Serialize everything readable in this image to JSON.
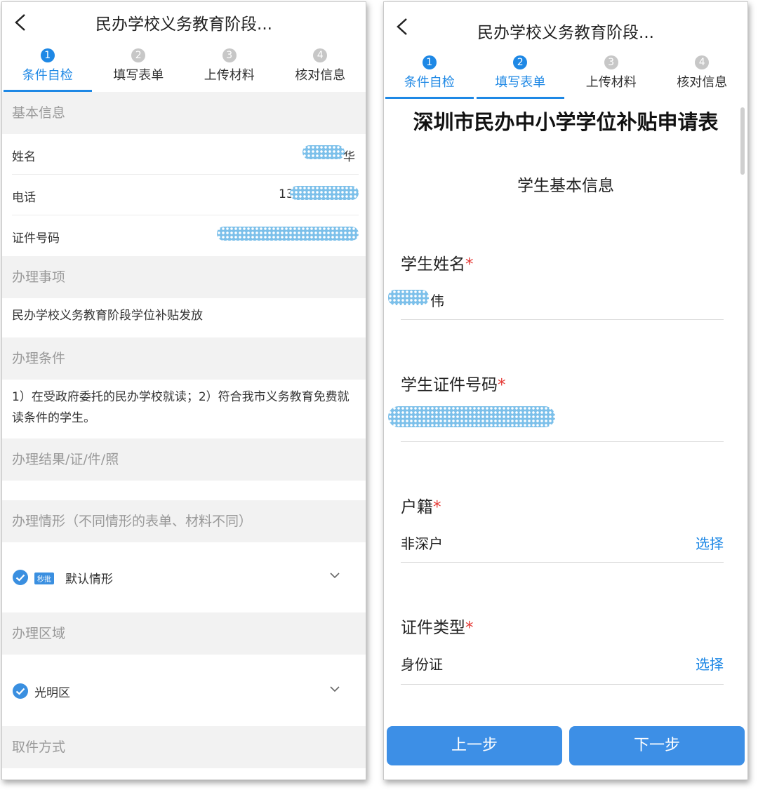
{
  "left_screen": {
    "title": "民办学校义务教育阶段...",
    "steps": [
      {
        "num": "1",
        "label": "条件自检"
      },
      {
        "num": "2",
        "label": "填写表单"
      },
      {
        "num": "3",
        "label": "上传材料"
      },
      {
        "num": "4",
        "label": "核对信息"
      }
    ],
    "basic_info_header": "基本信息",
    "name_label": "姓名",
    "name_value_suffix": "华",
    "phone_label": "电话",
    "phone_value_prefix": "13",
    "id_label": "证件号码",
    "matter_header": "办理事项",
    "matter_text": "民办学校义务教育阶段学位补贴发放",
    "condition_header": "办理条件",
    "condition_text": "1）在受政府委托的民办学校就读；2）符合我市义务教育免费就读条件的学生。",
    "result_header": "办理结果/证/件/照",
    "situation_header": "办理情形（不同情形的表单、材料不同）",
    "situation_tag": "秒批",
    "situation_value": "默认情形",
    "area_header": "办理区域",
    "area_value": "光明区",
    "pickup_header": "取件方式"
  },
  "right_screen": {
    "title": "民办学校义务教育阶段...",
    "steps": [
      {
        "num": "1",
        "label": "条件自检"
      },
      {
        "num": "2",
        "label": "填写表单"
      },
      {
        "num": "3",
        "label": "上传材料"
      },
      {
        "num": "4",
        "label": "核对信息"
      }
    ],
    "form_title": "深圳市民办中小学学位补贴申请表",
    "form_subtitle": "学生基本信息",
    "student_name_label": "学生姓名",
    "student_name_suffix": "伟",
    "student_id_label": "学生证件号码",
    "huji_label": "户籍",
    "huji_value": "非深户",
    "id_type_label": "证件类型",
    "id_type_value": "身份证",
    "select_label": "选择",
    "required_mark": "*",
    "prev_button": "上一步",
    "next_button": "下一步"
  },
  "colors": {
    "accent": "#1e88e5",
    "button": "#3d8fe6",
    "required": "#e53935",
    "section_bg": "#f2f2f2"
  }
}
